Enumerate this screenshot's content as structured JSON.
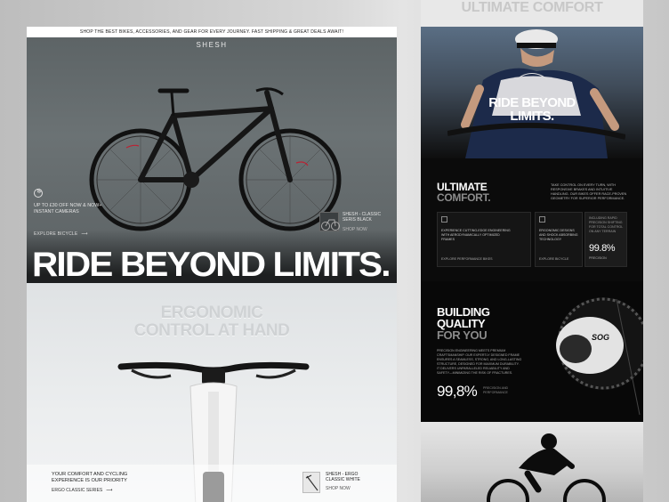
{
  "left": {
    "announcement": "SHOP THE BEST BIKES, ACCESSORIES, AND GEAR FOR EVERY JOURNEY. FAST SHIPPING & GREAT DEALS AWAIT!",
    "logo": "SHESH",
    "promo": "UP TO £30 OFF NOW & NOW+ INSTANT CAMERAS",
    "explore_link": "EXPLORE BICYCLE",
    "product_card": {
      "name": "SHESH - CLASSIC SERIS BLACK",
      "cta": "SHOP NOW"
    },
    "hero_title": "RIDE BEYOND LIMITS.",
    "ergo_title_line1": "ERGONOMIC",
    "ergo_title_line2": "CONTROL AT HAND",
    "comfort_text": "YOUR COMFORT AND CYCLING EXPERIENCE IS OUR PRIORITY",
    "series_link": "ERGO CLASSIC SERIES",
    "product_card2": {
      "name": "SHESH - ERGO CLASSIC WHITE",
      "cta": "SHOP NOW"
    }
  },
  "right": {
    "top_title": "ULTIMATE COMFORT",
    "hero_line1": "RIDE BEYOND",
    "hero_line2": "LIMITS.",
    "ultimate": {
      "title1": "ULTIMATE",
      "title2": "COMFORT.",
      "desc": "TAKE CONTROL ON EVERY TURN, WITH RESPONSIVE BRAKES AND INTUITIVE HANDLING. OUR BIKES OFFER RACE-PROVEN GEOMETRY FOR SUPERIOR PERFORMANCE.",
      "box1_text": "EXPERIENCE CUTTING-EDGE ENGINEERING WITH AERODYNAMICALLY OPTIMIZED FRAMES",
      "box1_link": "EXPLORE PERFORMANCE BIKES",
      "box2_text": "ERGONOMIC DESIGNS AND SHOCK ABSORBING TECHNOLOGY",
      "box2_link": "EXPLORE BICYCLE",
      "box3_text": "INCLUDING RAPID PRECISION SHIFTING FOR TOTAL CONTROL ON ANY TERRAIN",
      "box3_pct": "99.8%",
      "box3_label": "PRECISION"
    },
    "building": {
      "title1": "BUILDING QUALITY",
      "title2": "FOR YOU",
      "desc": "PRECISION ENGINEERING MEETS PREMIUM CRAFTSMANSHIP. OUR EXPERTLY DESIGNED FRAME ENSURES A SEAMLESS, STRONG, AND LONG-LASTING STRUCTURE, DESIGNED FOR MAXIMUM DURABILITY. IT DELIVERS UNPARALLELED RELIABILITY AND SAFETY—MINIMIZING THE RISK OF FRACTURES.",
      "pct": "99,8%",
      "pct_label": "PRECISION AND PERFORMANCE"
    }
  }
}
